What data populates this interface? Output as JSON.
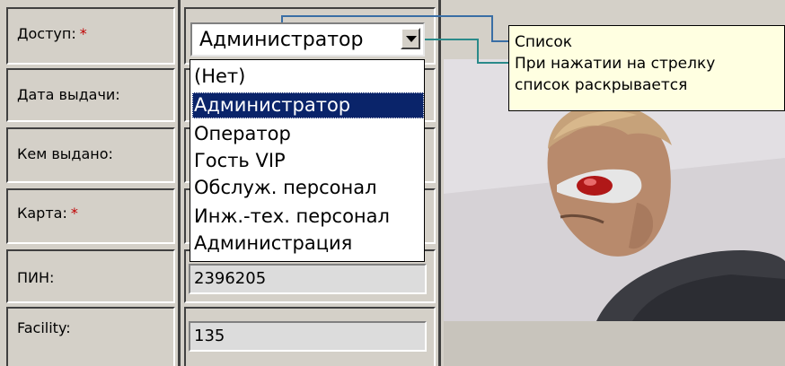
{
  "form": {
    "fields": [
      {
        "label": "Доступ:",
        "required": "*"
      },
      {
        "label": "Дата выдачи:"
      },
      {
        "label": "Кем выдано:"
      },
      {
        "label": "Карта:",
        "required": "*"
      },
      {
        "label": "ПИН:",
        "value": "2396205"
      },
      {
        "label": "Facility:",
        "value": "135"
      }
    ]
  },
  "select": {
    "value": "Администратор",
    "options": [
      "(Нет)",
      "Администратор",
      "Оператор",
      "Гость VIP",
      "Обслуж. персонал",
      "Инж.-тех. персонал",
      "Администрация"
    ],
    "selected_index": 1
  },
  "callout": {
    "line1": "Список",
    "line2": "При нажатии на стрелку",
    "line3": "список раскрывается"
  },
  "colors": {
    "background": "#d4d0c8",
    "selection": "#0a246a",
    "tooltip": "#ffffe1",
    "required": "#c00000",
    "connector": "#3a6ea5"
  }
}
